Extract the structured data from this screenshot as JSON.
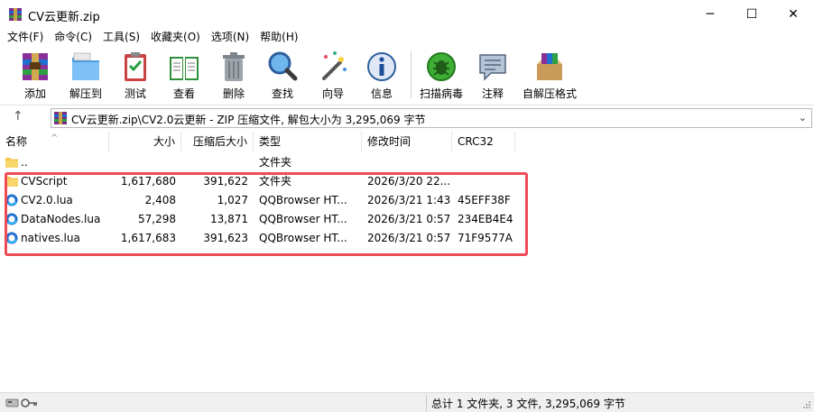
{
  "window": {
    "title": "CV云更新.zip",
    "min_glyph": "─",
    "max_glyph": "☐",
    "close_glyph": "✕"
  },
  "menu": [
    "文件(F)",
    "命令(C)",
    "工具(S)",
    "收藏夹(O)",
    "选项(N)",
    "帮助(H)"
  ],
  "toolbar": {
    "add": "添加",
    "extract": "解压到",
    "test": "测试",
    "view": "查看",
    "delete": "删除",
    "find": "查找",
    "wizard": "向导",
    "info": "信息",
    "scan": "扫描病毒",
    "comment": "注释",
    "sfx": "自解压格式"
  },
  "address": {
    "up_glyph": "↑",
    "path": "CV云更新.zip\\CV2.0云更新 - ZIP 压缩文件, 解包大小为 3,295,069 字节",
    "dropdown_glyph": "⌄"
  },
  "columns": {
    "name": "名称",
    "size": "大小",
    "packed": "压缩后大小",
    "type": "类型",
    "modified": "修改时间",
    "crc": "CRC32"
  },
  "files": [
    {
      "icon": "folder-icon",
      "name": "..",
      "size": "",
      "packed": "",
      "type": "文件夹",
      "modified": "",
      "crc": ""
    },
    {
      "icon": "folder-icon",
      "name": "CVScript",
      "size": "1,617,680",
      "packed": "391,622",
      "type": "文件夹",
      "modified": "2026/3/20 22...",
      "crc": ""
    },
    {
      "icon": "browser-file-icon",
      "name": "CV2.0.lua",
      "size": "2,408",
      "packed": "1,027",
      "type": "QQBrowser HT...",
      "modified": "2026/3/21 1:43",
      "crc": "45EFF38F"
    },
    {
      "icon": "browser-file-icon",
      "name": "DataNodes.lua",
      "size": "57,298",
      "packed": "13,871",
      "type": "QQBrowser HT...",
      "modified": "2026/3/21 0:57",
      "crc": "234EB4E4"
    },
    {
      "icon": "browser-file-icon",
      "name": "natives.lua",
      "size": "1,617,683",
      "packed": "391,623",
      "type": "QQBrowser HT...",
      "modified": "2026/3/21 0:57",
      "crc": "71F9577A"
    }
  ],
  "status": {
    "summary": "总计 1 文件夹, 3 文件, 3,295,069 字节"
  },
  "colors": {
    "highlight": "#ef4b55",
    "folder": "#f5c84c",
    "browser_icon": "#1e6fd0"
  }
}
